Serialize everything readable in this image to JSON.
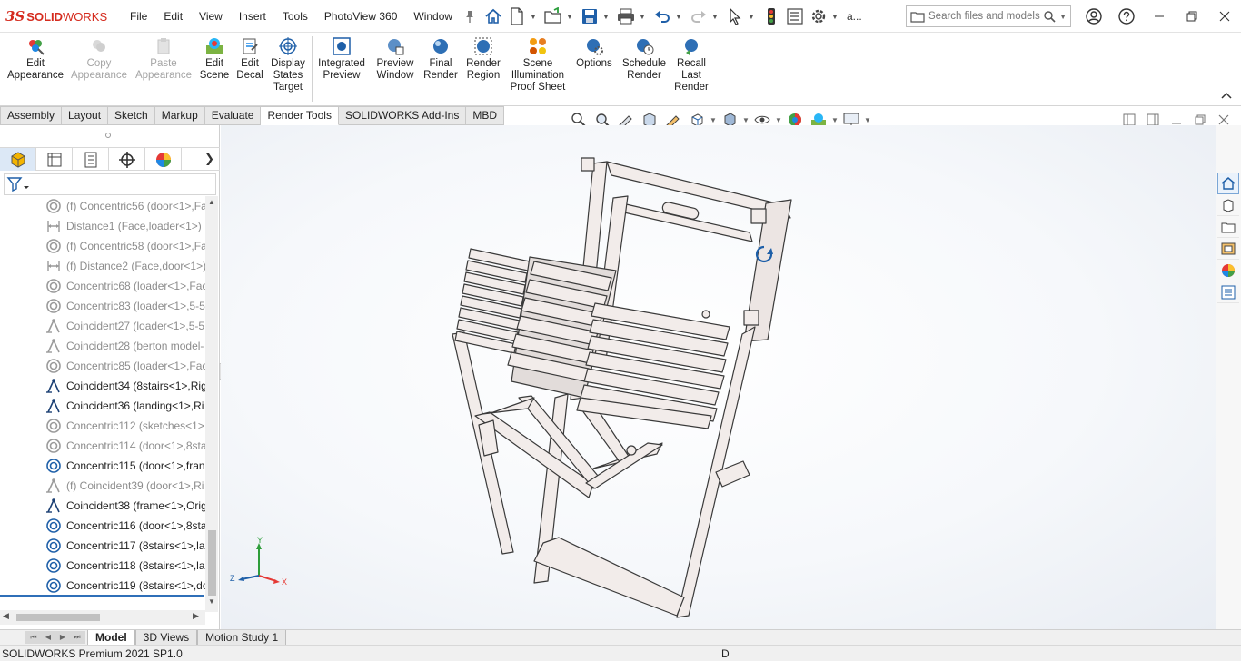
{
  "app": {
    "logo_prefix": "3S",
    "logo_bold": "SOLID",
    "logo_rest": "WORKS"
  },
  "menu": [
    "File",
    "Edit",
    "View",
    "Insert",
    "Tools",
    "PhotoView 360",
    "Window"
  ],
  "quick_access": {
    "more_label": "a..."
  },
  "search": {
    "placeholder": "Search files and models"
  },
  "ribbon": {
    "buttons": [
      {
        "label": "Edit\nAppearance",
        "enabled": true
      },
      {
        "label": "Copy\nAppearance",
        "enabled": false
      },
      {
        "label": "Paste\nAppearance",
        "enabled": false
      },
      {
        "label": "Edit\nScene",
        "enabled": true
      },
      {
        "label": "Edit\nDecal",
        "enabled": true
      },
      {
        "label": "Display\nStates\nTarget",
        "enabled": true
      },
      {
        "label": "Integrated\nPreview",
        "enabled": true
      },
      {
        "label": "Preview\nWindow",
        "enabled": true
      },
      {
        "label": "Final\nRender",
        "enabled": true
      },
      {
        "label": "Render\nRegion",
        "enabled": true
      },
      {
        "label": "Scene\nIllumination\nProof Sheet",
        "enabled": true
      },
      {
        "label": "Options",
        "enabled": true
      },
      {
        "label": "Schedule\nRender",
        "enabled": true
      },
      {
        "label": "Recall\nLast\nRender",
        "enabled": true
      }
    ]
  },
  "command_tabs": [
    {
      "label": "Assembly",
      "active": false
    },
    {
      "label": "Layout",
      "active": false
    },
    {
      "label": "Sketch",
      "active": false
    },
    {
      "label": "Markup",
      "active": false
    },
    {
      "label": "Evaluate",
      "active": false
    },
    {
      "label": "Render Tools",
      "active": true
    },
    {
      "label": "SOLIDWORKS Add-Ins",
      "active": false
    },
    {
      "label": "MBD",
      "active": false
    }
  ],
  "feature_tree": {
    "items": [
      {
        "label": "(f) Concentric56 (door<1>,Fa",
        "icon": "concentric",
        "dim": true
      },
      {
        "label": "Distance1 (Face,loader<1>)",
        "icon": "distance",
        "dim": true
      },
      {
        "label": "(f) Concentric58 (door<1>,Fa",
        "icon": "concentric",
        "dim": true
      },
      {
        "label": "(f) Distance2 (Face,door<1>)",
        "icon": "distance",
        "dim": true
      },
      {
        "label": "Concentric68 (loader<1>,Fac",
        "icon": "concentric",
        "dim": true
      },
      {
        "label": "Concentric83 (loader<1>,5-5",
        "icon": "concentric",
        "dim": true
      },
      {
        "label": "Coincident27 (loader<1>,5-5",
        "icon": "coincident",
        "dim": true
      },
      {
        "label": "Coincident28 (berton model-",
        "icon": "coincident",
        "dim": true
      },
      {
        "label": "Concentric85 (loader<1>,Fac",
        "icon": "concentric",
        "dim": true
      },
      {
        "label": "Coincident34 (8stairs<1>,Rig",
        "icon": "coincident",
        "dim": false
      },
      {
        "label": "Coincident36 (landing<1>,Ri",
        "icon": "coincident",
        "dim": false
      },
      {
        "label": "Concentric112 (sketches<1>,",
        "icon": "concentric",
        "dim": true
      },
      {
        "label": "Concentric114 (door<1>,8sta",
        "icon": "concentric",
        "dim": true
      },
      {
        "label": "Concentric115 (door<1>,fran",
        "icon": "concentric",
        "dim": false
      },
      {
        "label": "(f) Coincident39 (door<1>,Ri",
        "icon": "coincident",
        "dim": true
      },
      {
        "label": "Coincident38 (frame<1>,Orig",
        "icon": "coincident",
        "dim": false
      },
      {
        "label": "Concentric116 (door<1>,8sta",
        "icon": "concentric",
        "dim": false
      },
      {
        "label": "Concentric117 (8stairs<1>,la",
        "icon": "concentric",
        "dim": false
      },
      {
        "label": "Concentric118 (8stairs<1>,la",
        "icon": "concentric",
        "dim": false
      },
      {
        "label": "Concentric119 (8stairs<1>,do",
        "icon": "concentric",
        "dim": false
      }
    ]
  },
  "triad": {
    "x": "X",
    "y": "Y",
    "z": "Z"
  },
  "bottom_tabs": [
    {
      "label": "Model",
      "active": true
    },
    {
      "label": "3D Views",
      "active": false
    },
    {
      "label": "Motion Study 1",
      "active": false
    }
  ],
  "status": {
    "product": "SOLIDWORKS Premium 2021 SP1.0",
    "right": "D"
  },
  "colors": {
    "brand_red": "#d52b1e",
    "selection_blue": "#2f6fb8",
    "model_fill": "#f2ecea",
    "model_stroke": "#3a3a3a"
  }
}
